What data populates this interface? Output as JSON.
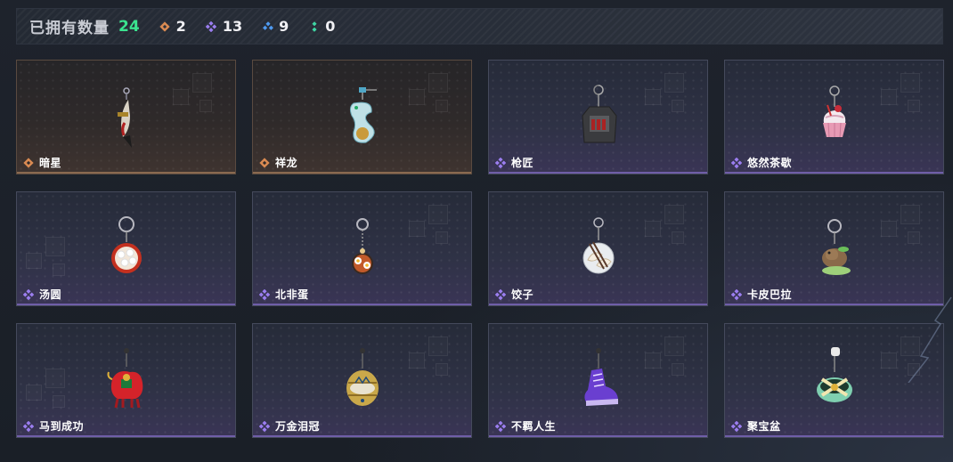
{
  "summary": {
    "label": "已拥有数量",
    "total": "24",
    "stats": [
      {
        "icon": "orange-diamond-icon",
        "color": "#d98a52",
        "value": "2"
      },
      {
        "icon": "purple-diamond-icon",
        "color": "#9b7ef0",
        "value": "13"
      },
      {
        "icon": "blue-diamond-icon",
        "color": "#4f9bf2",
        "value": "9"
      },
      {
        "icon": "green-diamond-icon",
        "color": "#3fd6a3",
        "value": "0"
      }
    ]
  },
  "colors": {
    "total_green": "#3be38f",
    "rarity_orange": "#d98a52",
    "rarity_purple": "#9b7ef0"
  },
  "items": [
    {
      "name": "暗星",
      "rarity": "orange",
      "pendant": "dagger-charm-icon"
    },
    {
      "name": "祥龙",
      "rarity": "orange",
      "pendant": "dragon-charm-icon"
    },
    {
      "name": "枪匠",
      "rarity": "purple",
      "pendant": "backpack-charm-icon"
    },
    {
      "name": "悠然茶歇",
      "rarity": "purple",
      "pendant": "cupcake-charm-icon"
    },
    {
      "name": "汤圆",
      "rarity": "purple",
      "pendant": "tangyuan-bowl-charm-icon"
    },
    {
      "name": "北非蛋",
      "rarity": "purple",
      "pendant": "shakshuka-charm-icon"
    },
    {
      "name": "饺子",
      "rarity": "purple",
      "pendant": "dumpling-charm-icon"
    },
    {
      "name": "卡皮巴拉",
      "rarity": "purple",
      "pendant": "capybara-charm-icon"
    },
    {
      "name": "马到成功",
      "rarity": "purple",
      "pendant": "red-horse-charm-icon"
    },
    {
      "name": "万金泪冠",
      "rarity": "purple",
      "pendant": "crown-egg-charm-icon"
    },
    {
      "name": "不羁人生",
      "rarity": "purple",
      "pendant": "sneaker-charm-icon"
    },
    {
      "name": "聚宝盆",
      "rarity": "purple",
      "pendant": "treasure-bowl-charm-icon"
    }
  ]
}
